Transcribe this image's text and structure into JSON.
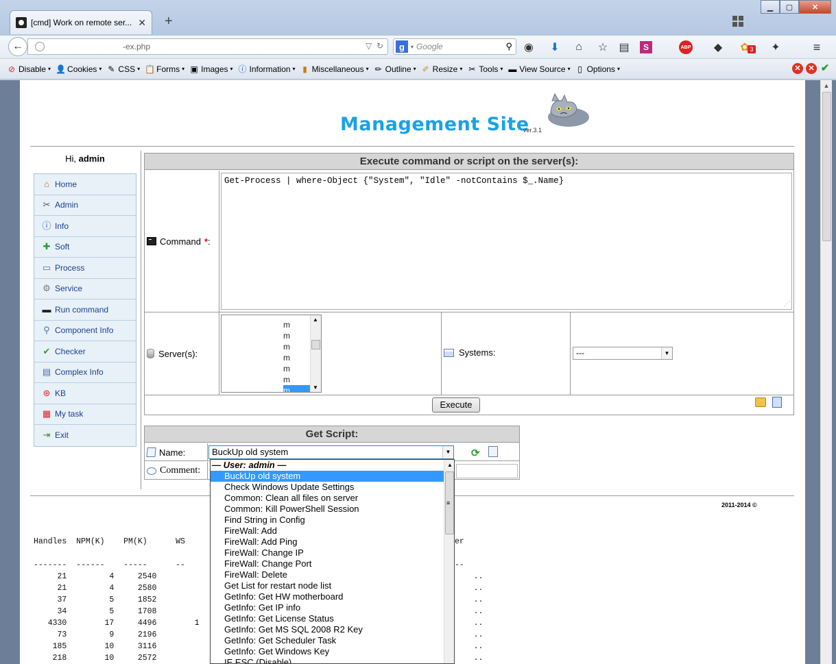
{
  "browser": {
    "tab_title": "[cmd] Work on remote ser...",
    "url_fragment": "-ex.php",
    "search_placeholder": "Google",
    "adblock_label": "ABP",
    "badge_count": "3"
  },
  "devbar": {
    "items": [
      "Disable",
      "Cookies",
      "CSS",
      "Forms",
      "Images",
      "Information",
      "Miscellaneous",
      "Outline",
      "Resize",
      "Tools",
      "View Source",
      "Options"
    ]
  },
  "site": {
    "logo": "Management Site",
    "version": "ver.3.1",
    "greeting_prefix": "Hi, ",
    "username": "admin",
    "copyright": "2011-2014 ©"
  },
  "menu": [
    {
      "label": "Home",
      "icon": "home-icon"
    },
    {
      "label": "Admin",
      "icon": "tools-icon"
    },
    {
      "label": "Info",
      "icon": "info-icon"
    },
    {
      "label": "Soft",
      "icon": "puzzle-icon"
    },
    {
      "label": "Process",
      "icon": "window-icon"
    },
    {
      "label": "Service",
      "icon": "gear-icon"
    },
    {
      "label": "Run command",
      "icon": "terminal-icon"
    },
    {
      "label": "Component Info",
      "icon": "magnifier-icon"
    },
    {
      "label": "Checker",
      "icon": "checkmark-icon"
    },
    {
      "label": "Complex Info",
      "icon": "form-icon"
    },
    {
      "label": "KB",
      "icon": "lifebuoy-icon"
    },
    {
      "label": "My task",
      "icon": "calendar-icon"
    },
    {
      "label": "Exit",
      "icon": "exit-icon"
    }
  ],
  "execute": {
    "title": "Execute command or script on the server(s):",
    "command_label": "Command",
    "required_mark": "*",
    "command_suffix": ":",
    "command_value": "Get-Process | where-Object {\"System\", \"Idle\" -notContains $_.Name}",
    "servers_label": "Server(s):",
    "server_items": [
      "m",
      "m",
      "m",
      "m",
      "m",
      "m",
      "m"
    ],
    "systems_label": "Systems:",
    "systems_value": "---",
    "execute_button": "Execute"
  },
  "get_script": {
    "title": "Get Script:",
    "name_label": "Name:",
    "name_value": "BuckUp old system",
    "comment_label": "Comment:",
    "dropdown_group": "— User: admin —",
    "dropdown_options": [
      "BuckUp old system",
      "Check Windows Update Settings",
      "Common: Clean all files on server",
      "Common: Kill PowerShell Session",
      "Find String in Config",
      "FireWall: Add",
      "FireWall: Add Ping",
      "FireWall: Change IP",
      "FireWall: Change Port",
      "FireWall: Delete",
      "Get List for restart node list",
      "GetInfo: Get HW motherboard",
      "GetInfo: Get IP info",
      "GetInfo: Get License Status",
      "GetInfo: Get MS SQL 2008 R2 Key",
      "GetInfo: Get Scheduler Task",
      "GetInfo: Get Windows Key",
      "IE ESC (Disable)"
    ],
    "selected_index": 0
  },
  "output": {
    "headers": [
      "Handles",
      "NPM(K)",
      "PM(K)",
      "WS"
    ],
    "header_tail": "er",
    "rows": [
      [
        "21",
        "4",
        "2540",
        ""
      ],
      [
        "21",
        "4",
        "2580",
        ""
      ],
      [
        "37",
        "5",
        "1852",
        ""
      ],
      [
        "34",
        "5",
        "1708",
        ""
      ],
      [
        "4330",
        "17",
        "4496",
        "1"
      ],
      [
        "73",
        "9",
        "2196",
        ""
      ],
      [
        "185",
        "10",
        "3116",
        ""
      ],
      [
        "218",
        "10",
        "2572",
        ""
      ]
    ],
    "row_tail": ".."
  }
}
